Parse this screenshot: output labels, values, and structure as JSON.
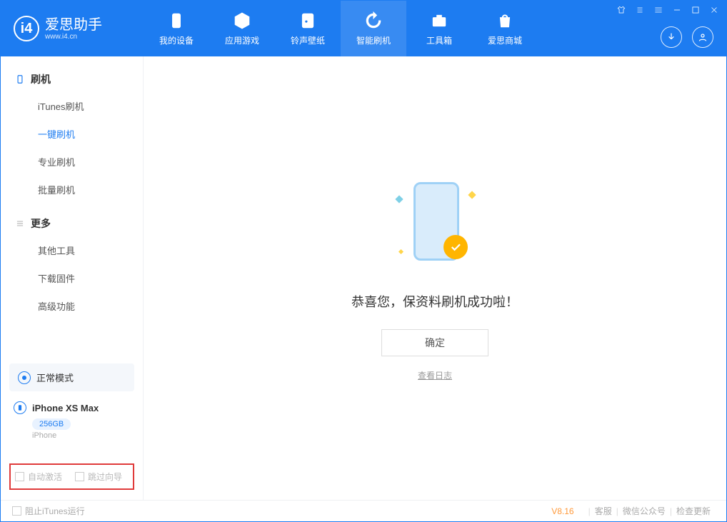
{
  "brand": {
    "name": "爱思助手",
    "url": "www.i4.cn"
  },
  "nav": {
    "my_device": "我的设备",
    "app_games": "应用游戏",
    "ringtones": "铃声壁纸",
    "smart_flash": "智能刷机",
    "toolbox": "工具箱",
    "store": "爱思商城"
  },
  "sidebar": {
    "section_flash": "刷机",
    "itunes_flash": "iTunes刷机",
    "one_click_flash": "一键刷机",
    "pro_flash": "专业刷机",
    "batch_flash": "批量刷机",
    "section_more": "更多",
    "other_tools": "其他工具",
    "download_firmware": "下载固件",
    "advanced": "高级功能"
  },
  "device": {
    "mode": "正常模式",
    "name": "iPhone XS Max",
    "capacity": "256GB",
    "type": "iPhone"
  },
  "options": {
    "auto_activate": "自动激活",
    "skip_guide": "跳过向导"
  },
  "main": {
    "success_msg": "恭喜您，保资料刷机成功啦！",
    "ok": "确定",
    "view_log": "查看日志"
  },
  "footer": {
    "block_itunes": "阻止iTunes运行",
    "version": "V8.16",
    "support": "客服",
    "wechat": "微信公众号",
    "check_update": "检查更新"
  }
}
